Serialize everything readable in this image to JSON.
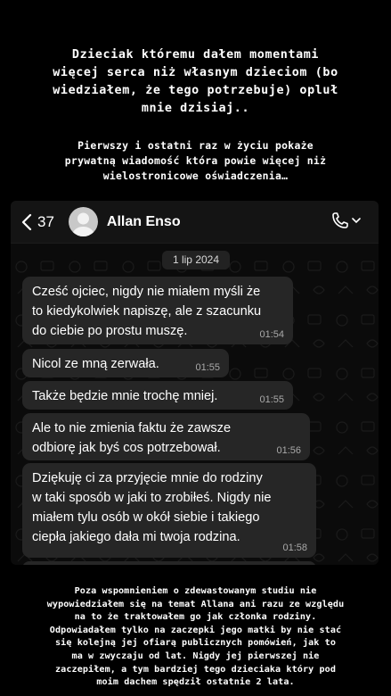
{
  "story": {
    "headline": "Dzieciak któremu dałem momentami\nwięcej serca niż własnym dzieciom (bo\nwiedziałem, że tego potrzebuje) opluł\nmnie dzisiaj..",
    "subline": "Pierwszy i ostatni raz w życiu pokaże\nprywatną wiadomość która powie więcej niż\nwielostronicowe oświadczenia…",
    "footer": "Poza wspomnieniem o zdewastowanym studiu nie\nwypowiedziałem się na temat Allana ani razu ze względu\nna to że traktowałem go jak członka rodziny.\nOdpowiadałem tylko na zaczepki jego matki by nie stać\nsię  kolejną jej ofiarą publicznych pomówień, jak to\nma w zwyczaju od lat. Nigdy jej pierwszej nie\nzaczepiłem, a tym bardziej tego dzieciaka który pod\nmoim dachem spędził ostatnie 2 lata."
  },
  "chat": {
    "back_count": "37",
    "contact_name": "Allan Enso",
    "date_separator": "1 lip 2024",
    "icons": {
      "back": "chevron-left-icon",
      "avatar": "default-avatar-icon",
      "call": "phone-icon",
      "call_menu": "chevron-down-icon"
    },
    "messages": [
      {
        "text": "Cześć ojciec, nigdy nie miałem myśli że\nto kiedykolwiek napiszę, ale z szacunku\ndo ciebie po prostu muszę.",
        "time": "01:54"
      },
      {
        "text": "Nicol ze mną zerwała.",
        "time": "01:55"
      },
      {
        "text": "Także będzie mnie trochę mniej.",
        "time": "01:55"
      },
      {
        "text": "Ale to nie zmienia faktu że zawsze\nodbiorę jak byś cos potrzebował.",
        "time": "01:56"
      },
      {
        "text": "Dziękuję ci za przyjęcie mnie do rodziny\nw taki sposób w jaki to zrobiłeś. Nigdy nie\nmiałem tylu osób w okół siebie i takiego\nciepła jakiego dała mi twoja rodzina.",
        "time": "01:58"
      }
    ]
  },
  "colors": {
    "background": "#000000",
    "bubble": "#262626",
    "header": "#141414",
    "timestamp": "#a9a9a9"
  }
}
